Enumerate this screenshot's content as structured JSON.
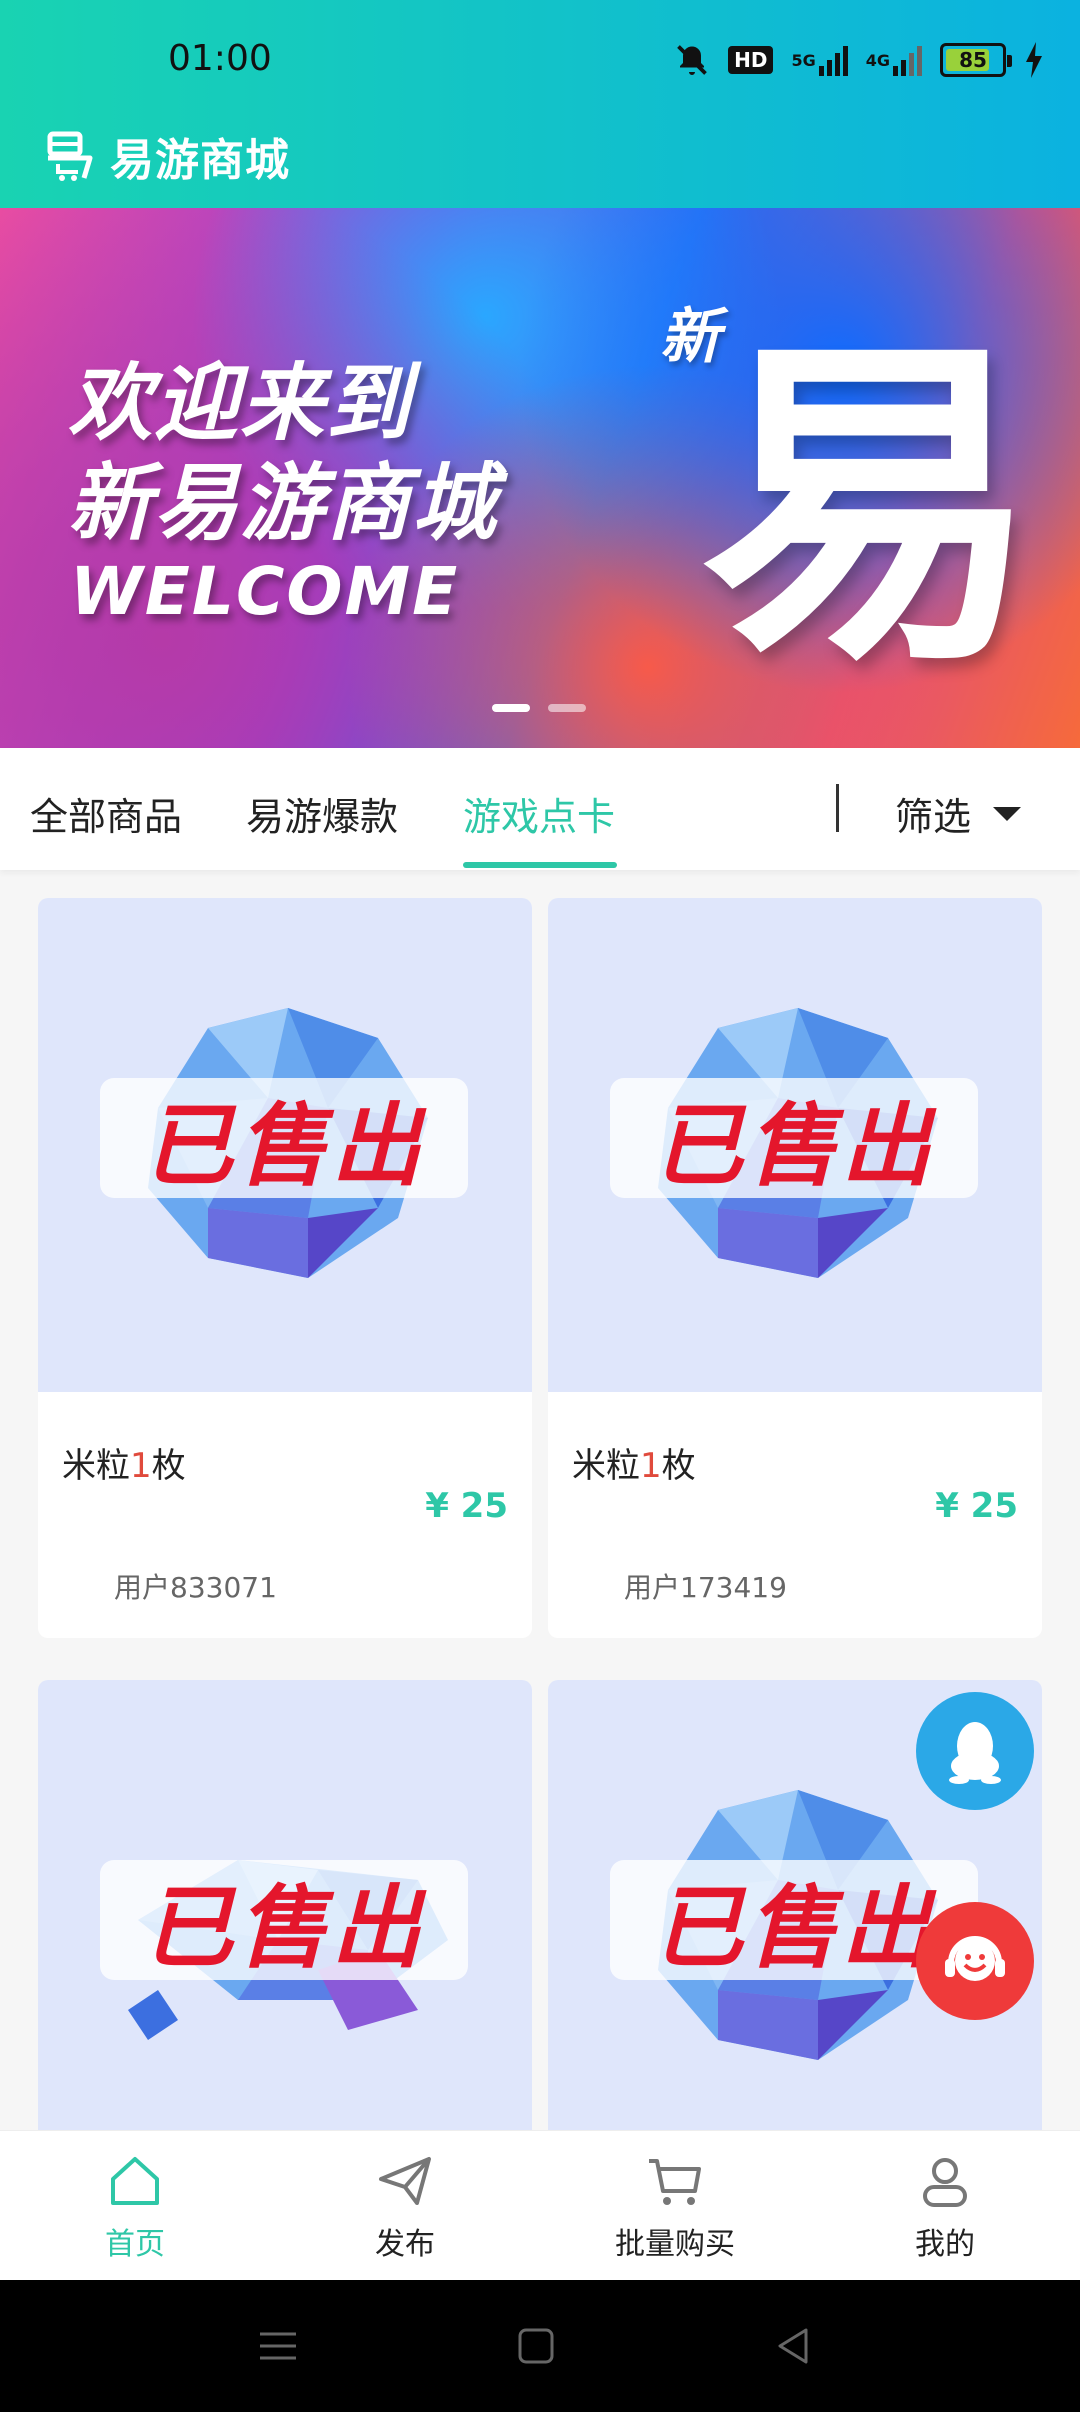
{
  "status_bar": {
    "time": "01:00",
    "battery": "85",
    "hd_label": "HD",
    "net1": "5G",
    "net2": "4G"
  },
  "app": {
    "title": "易游商城"
  },
  "banner": {
    "line1": "欢迎来到",
    "line2": "新易游商城",
    "line3": "WELCOME",
    "tag_new": "新",
    "big_char": "易"
  },
  "tabs": {
    "items": [
      "全部商品",
      "易游爆款",
      "游戏点卡"
    ],
    "active_index": 2,
    "filter_label": "筛选"
  },
  "products": [
    {
      "name": "米粒",
      "qty": "1",
      "unit": "枚",
      "price": "¥ 25",
      "seller": "用户833071",
      "badge": "已售出"
    },
    {
      "name": "米粒",
      "qty": "1",
      "unit": "枚",
      "price": "¥ 25",
      "seller": "用户173419",
      "badge": "已售出"
    },
    {
      "badge": "已售出"
    },
    {
      "badge": "已售出"
    }
  ],
  "bottom_nav": {
    "items": [
      {
        "label": "首页",
        "icon": "home-icon"
      },
      {
        "label": "发布",
        "icon": "send-icon"
      },
      {
        "label": "批量购买",
        "icon": "cart-icon"
      },
      {
        "label": "我的",
        "icon": "user-icon"
      }
    ],
    "active_index": 0
  },
  "colors": {
    "accent": "#2ec7a7",
    "sold": "#e4162c",
    "qq": "#2ba8e7",
    "service": "#ef3a3a"
  }
}
